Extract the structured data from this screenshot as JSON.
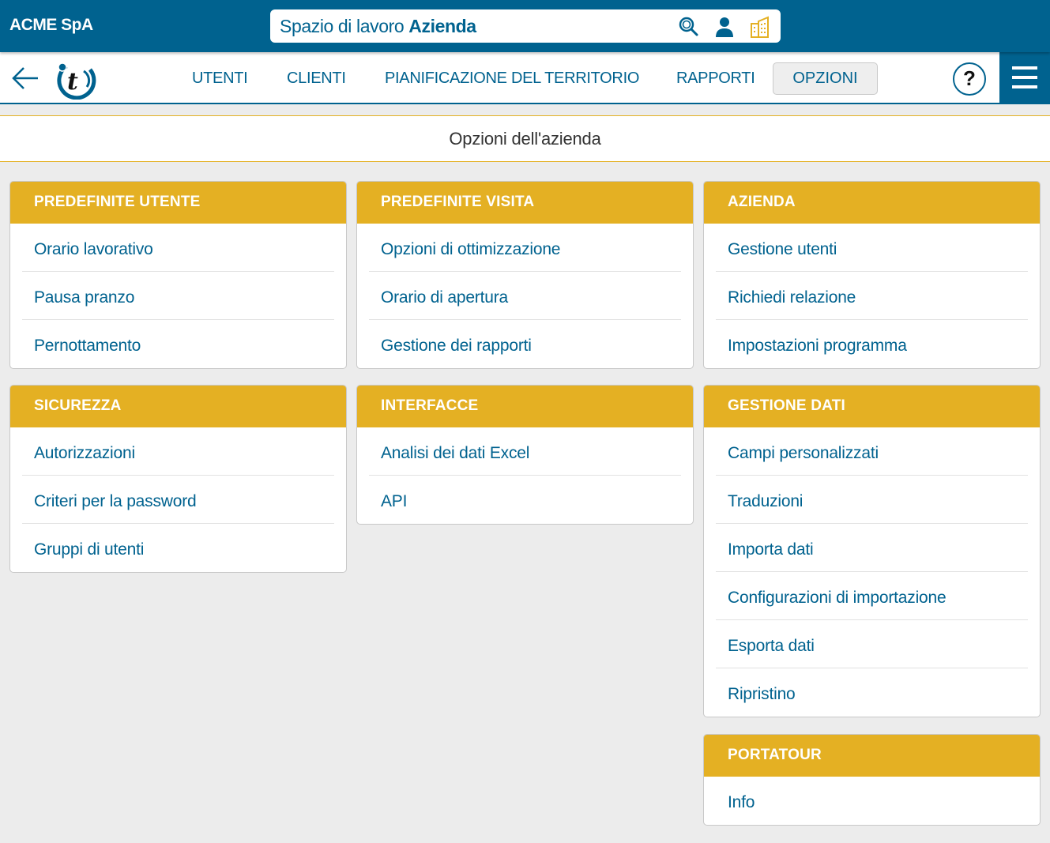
{
  "header": {
    "company": "ACME SpA",
    "workspace_prefix": "Spazio di lavoro",
    "workspace_name": "Azienda",
    "icons": [
      "search-icon",
      "user-icon",
      "building-icon"
    ]
  },
  "nav": {
    "items": [
      {
        "label": "UTENTI"
      },
      {
        "label": "CLIENTI"
      },
      {
        "label": "PIANIFICAZIONE DEL TERRITORIO"
      },
      {
        "label": "RAPPORTI"
      },
      {
        "label": "OPZIONI",
        "active": true
      }
    ],
    "help_label": "?"
  },
  "page_title": "Opzioni dell'azienda",
  "colors": {
    "primary": "#00628f",
    "accent": "#e4b023",
    "background": "#ececec"
  },
  "cards": [
    {
      "title": "PREDEFINITE UTENTE",
      "items": [
        "Orario lavorativo",
        "Pausa pranzo",
        "Pernottamento"
      ]
    },
    {
      "title": "PREDEFINITE VISITA",
      "items": [
        "Opzioni di ottimizzazione",
        "Orario di apertura",
        "Gestione dei rapporti"
      ]
    },
    {
      "title": "AZIENDA",
      "items": [
        "Gestione utenti",
        "Richiedi relazione",
        "Impostazioni programma"
      ]
    },
    {
      "title": "SICUREZZA",
      "items": [
        "Autorizzazioni",
        "Criteri per la password",
        "Gruppi di utenti"
      ]
    },
    {
      "title": "INTERFACCE",
      "items": [
        "Analisi dei dati Excel",
        "API"
      ]
    },
    {
      "title": "GESTIONE DATI",
      "items": [
        "Campi personalizzati",
        "Traduzioni",
        "Importa dati",
        "Configurazioni di importazione",
        "Esporta dati",
        "Ripristino"
      ]
    },
    {
      "title": "PORTATOUR",
      "items": [
        "Info"
      ]
    }
  ]
}
